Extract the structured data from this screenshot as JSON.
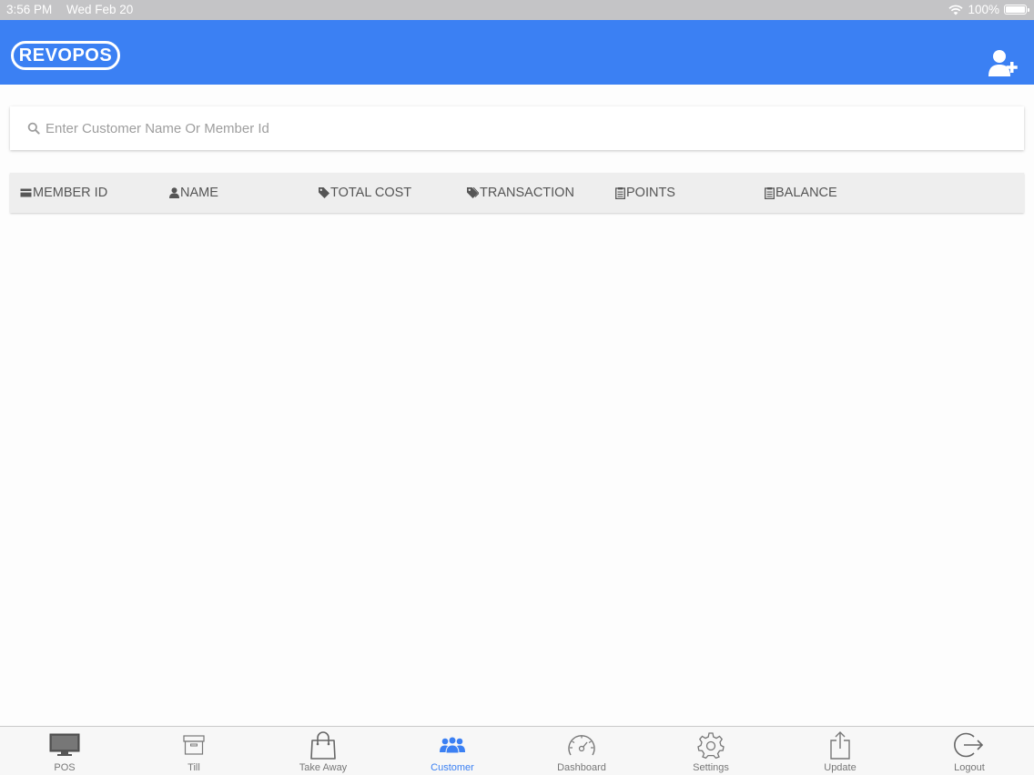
{
  "status_bar": {
    "time": "3:56 PM",
    "date": "Wed Feb 20",
    "battery": "100%",
    "icons": [
      "wifi-icon",
      "battery-icon"
    ]
  },
  "header": {
    "logo_text": "REVOPOS",
    "brand_color": "#3b80f3",
    "action_icon": "add-user-icon"
  },
  "search": {
    "placeholder": "Enter Customer Name Or Member Id",
    "value": "",
    "icon": "search-icon"
  },
  "table": {
    "columns": [
      {
        "label": "MEMBER ID",
        "icon": "card-icon"
      },
      {
        "label": "NAME",
        "icon": "person-icon"
      },
      {
        "label": "TOTAL COST",
        "icon": "tag-icon"
      },
      {
        "label": "TRANSACTION",
        "icon": "tags-icon"
      },
      {
        "label": "POINTS",
        "icon": "list-icon"
      },
      {
        "label": "BALANCE",
        "icon": "list-icon"
      }
    ],
    "rows": []
  },
  "tabs": [
    {
      "label": "POS",
      "icon": "monitor-icon"
    },
    {
      "label": "Till",
      "icon": "till-icon"
    },
    {
      "label": "Take Away",
      "icon": "shopping-bag-icon"
    },
    {
      "label": "Customer",
      "icon": "customers-icon",
      "active": true
    },
    {
      "label": "Dashboard",
      "icon": "gauge-icon"
    },
    {
      "label": "Settings",
      "icon": "gear-icon"
    },
    {
      "label": "Update",
      "icon": "share-icon"
    },
    {
      "label": "Logout",
      "icon": "logout-icon"
    }
  ],
  "colors": {
    "accent": "#3b80f3",
    "tab_inactive": "#777777",
    "header_row_bg": "#eeeeee"
  }
}
